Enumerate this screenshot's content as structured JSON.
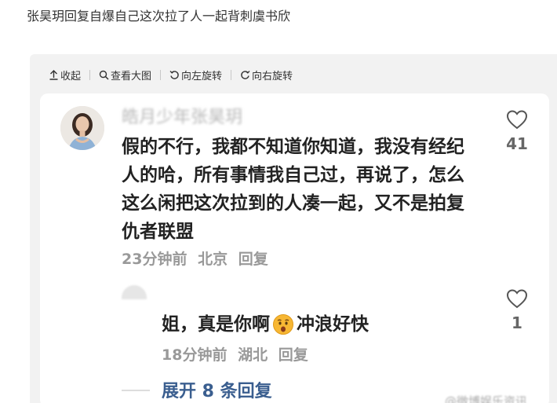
{
  "post": {
    "title": "张昊玥回复自爆自己这次拉了人一起背刺虞书欣"
  },
  "toolbar": {
    "collapse_label": "收起",
    "view_large_label": "查看大图",
    "rotate_left_label": "向左旋转",
    "rotate_right_label": "向右旋转"
  },
  "comment": {
    "username": "皓月少年张昊玥",
    "text": "假的不行，我都不知道你知道，我没有经纪人的哈，所有事情我自己过，再说了，怎么这么闲把这次拉到的人凑一起，又不是拍复仇者联盟",
    "time": "23分钟前",
    "location": "北京",
    "reply_label": "回复",
    "like_count": "41"
  },
  "reply": {
    "username": "",
    "text_before_emoji": "姐，真是你啊",
    "emoji": "astonished-face-emoji",
    "text_after_emoji": "冲浪好快",
    "time": "18分钟前",
    "location": "湖北",
    "reply_label": "回复",
    "like_count": "1"
  },
  "expand_label": "展开 8 条回复",
  "colors": {
    "link_blue": "#3a5e8f",
    "meta_gray": "#999999",
    "viewer_bg": "#f2f2f2"
  }
}
